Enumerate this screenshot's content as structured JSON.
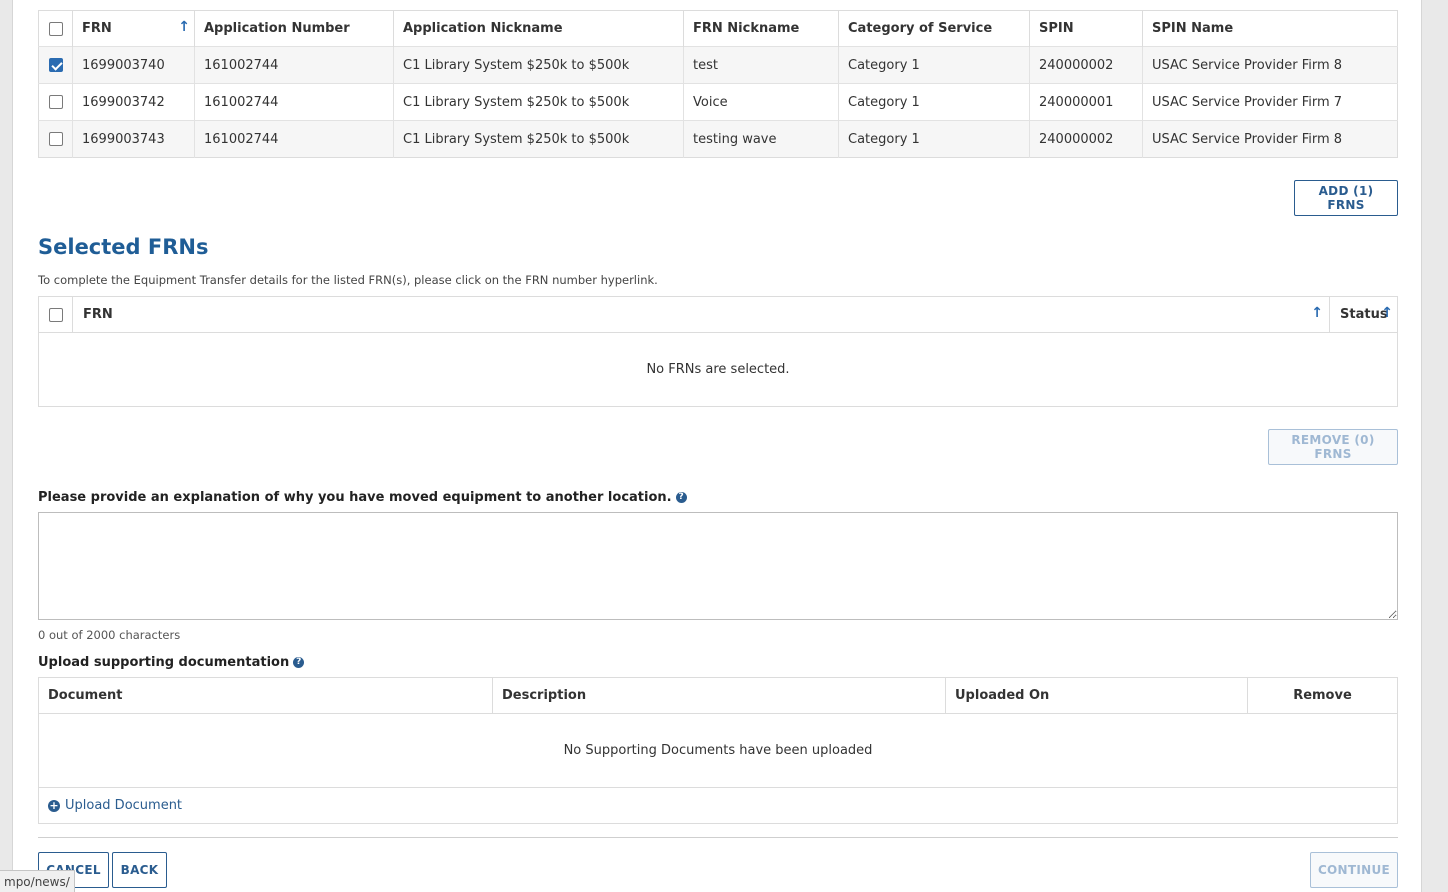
{
  "frn_table": {
    "columns": [
      "FRN",
      "Application Number",
      "Application Nickname",
      "FRN Nickname",
      "Category of Service",
      "SPIN",
      "SPIN Name"
    ],
    "rows": [
      {
        "checked": true,
        "frn": "1699003740",
        "app_number": "161002744",
        "app_nickname": "C1 Library System $250k to $500k",
        "frn_nickname": "test",
        "category": "Category 1",
        "spin": "240000002",
        "spin_name": "USAC Service Provider Firm 8"
      },
      {
        "checked": false,
        "frn": "1699003742",
        "app_number": "161002744",
        "app_nickname": "C1 Library System $250k to $500k",
        "frn_nickname": "Voice",
        "category": "Category 1",
        "spin": "240000001",
        "spin_name": "USAC Service Provider Firm 7"
      },
      {
        "checked": false,
        "frn": "1699003743",
        "app_number": "161002744",
        "app_nickname": "C1 Library System $250k to $500k",
        "frn_nickname": "testing wave",
        "category": "Category 1",
        "spin": "240000002",
        "spin_name": "USAC Service Provider Firm 8"
      }
    ]
  },
  "add_button": "ADD (1) FRNS",
  "selected": {
    "title": "Selected FRNs",
    "hint": "To complete the Equipment Transfer details for the listed FRN(s), please click on the FRN number hyperlink.",
    "col_frn": "FRN",
    "col_status": "Status",
    "empty": "No FRNs are selected.",
    "remove_button": "REMOVE (0) FRNS"
  },
  "explanation": {
    "label": "Please provide an explanation of why you have moved equipment to another location.",
    "value": "",
    "counter": "0 out of 2000 characters"
  },
  "upload": {
    "label": "Upload supporting documentation",
    "columns": [
      "Document",
      "Description",
      "Uploaded On",
      "Remove"
    ],
    "empty": "No Supporting Documents have been uploaded",
    "link": "Upload Document"
  },
  "footer": {
    "cancel": "CANCEL",
    "back": "BACK",
    "continue": "CONTINUE"
  },
  "statusbar_url": "mpo/news/",
  "colors": {
    "accent": "#2a5c8f",
    "heading": "#1f5d96",
    "checkbox": "#2a6bb1"
  }
}
